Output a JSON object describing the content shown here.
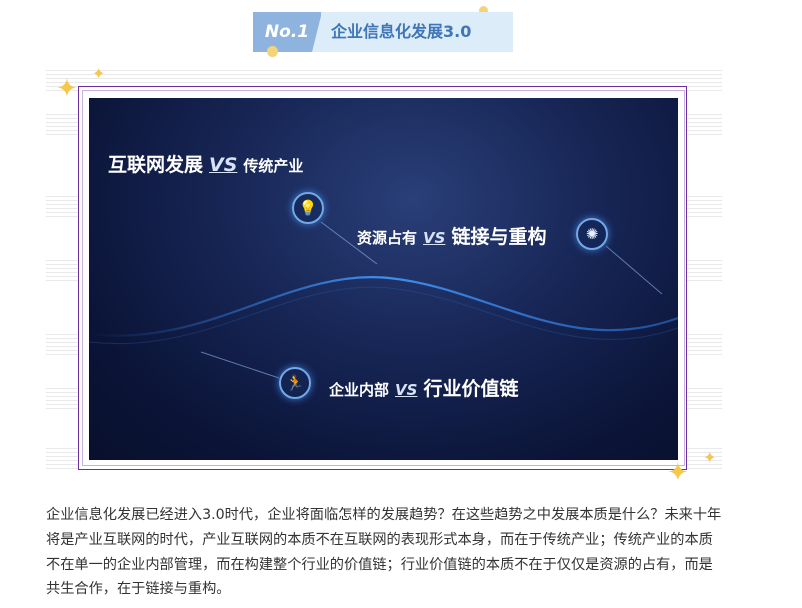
{
  "header": {
    "number": "No.1",
    "title": "企业信息化发展3.0"
  },
  "banner": {
    "line1": {
      "left": "互联网发展",
      "vs": "VS",
      "right": "传统产业"
    },
    "line2": {
      "left": "资源占有",
      "vs": "VS",
      "right": "链接与重构"
    },
    "line3": {
      "left": "企业内部",
      "vs": "VS",
      "right": "行业价值链"
    },
    "icons": [
      "lightbulb-icon",
      "aperture-icon",
      "running-person-icon"
    ]
  },
  "body_text": "企业信息化发展已经进入3.0时代，企业将面临怎样的发展趋势？在这些趋势之中发展本质是什么？未来十年将是产业互联网的时代，产业互联网的本质不在互联网的表现形式本身，而在于传统产业；传统产业的本质不在单一的企业内部管理，而在构建整个行业的价值链；行业价值链的本质不在于仅仅是资源的占有，而是共生合作，在于链接与重构。",
  "colors": {
    "accent_blue": "#3f76b8",
    "tab_blue": "#8fb3df",
    "tab_bg": "#dcecf8",
    "frame_purple": "#6a2ea0",
    "sparkle": "#f5c84a"
  }
}
